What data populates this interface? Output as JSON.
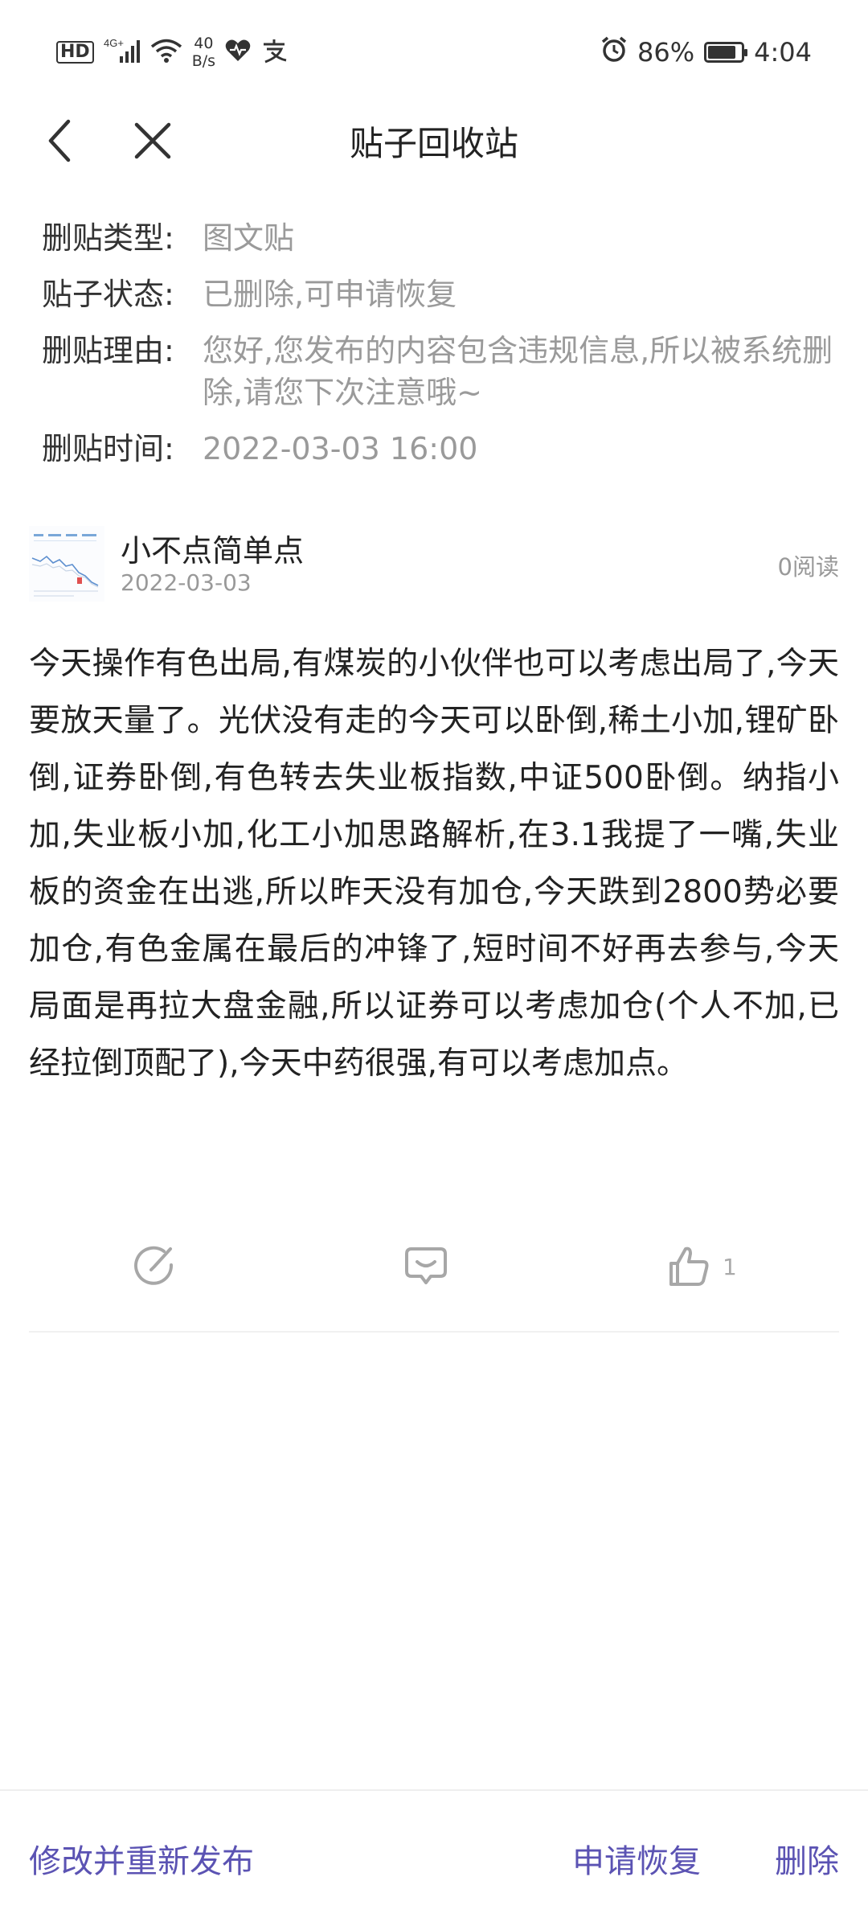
{
  "status_bar": {
    "hd": "HD",
    "network": "4G+",
    "speed_value": "40",
    "speed_unit": "B/s",
    "battery_percent": "86%",
    "battery_level": 0.86,
    "time": "4:04"
  },
  "nav": {
    "title": "贴子回收站"
  },
  "info": {
    "type_label": "删贴类型:",
    "type_value": "图文贴",
    "status_label": "贴子状态:",
    "status_value": "已删除,可申请恢复",
    "reason_label": "删贴理由:",
    "reason_value": "您好,您发布的内容包含违规信息,所以被系统删除,请您下次注意哦~",
    "time_label": "删贴时间:",
    "time_value": "2022-03-03 16:00"
  },
  "author": {
    "name": "小不点简单点",
    "date": "2022-03-03",
    "read_count": "0阅读"
  },
  "post": {
    "body": "今天操作有色出局,有煤炭的小伙伴也可以考虑出局了,今天要放天量了。光伏没有走的今天可以卧倒,稀土小加,锂矿卧倒,证券卧倒,有色转去失业板指数,中证500卧倒。纳指小加,失业板小加,化工小加思路解析,在3.1我提了一嘴,失业板的资金在出逃,所以昨天没有加仓,今天跌到2800势必要加仓,有色金属在最后的冲锋了,短时间不好再去参与,今天局面是再拉大盘金融,所以证券可以考虑加仓(个人不加,已经拉倒顶配了),今天中药很强,有可以考虑加点。"
  },
  "actions": {
    "like_count": "1"
  },
  "bottom": {
    "republish": "修改并重新发布",
    "restore": "申请恢复",
    "delete": "删除"
  },
  "colors": {
    "accent": "#5b53b3",
    "muted_text": "#9a9a9a",
    "icon_gray": "#a7a7a7"
  }
}
